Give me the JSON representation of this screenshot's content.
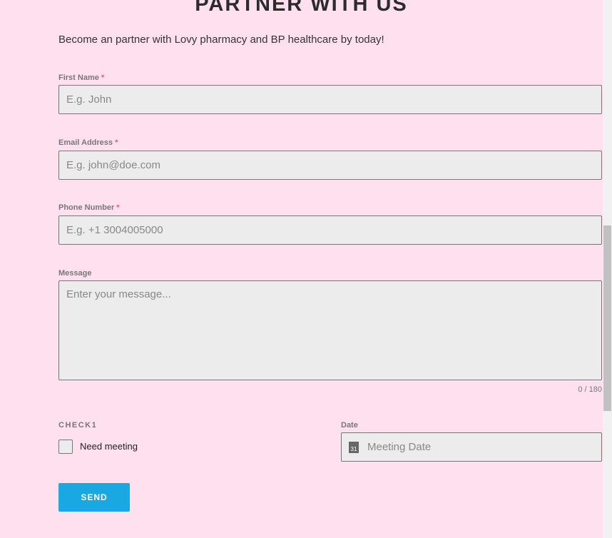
{
  "title": "PARTNER WITH US",
  "subtitle": "Become an partner with Lovy pharmacy and BP healthcare by today!",
  "fields": {
    "first_name": {
      "label": "First Name",
      "required": "*",
      "placeholder": "E.g. John"
    },
    "email": {
      "label": "Email Address",
      "required": "*",
      "placeholder": "E.g. john@doe.com"
    },
    "phone": {
      "label": "Phone Number",
      "required": "*",
      "placeholder": "E.g. +1 3004005000"
    },
    "message": {
      "label": "Message",
      "placeholder": "Enter your message...",
      "counter": "0 / 180"
    },
    "check": {
      "label": "CHECK1",
      "option": "Need meeting"
    },
    "date": {
      "label": "Date",
      "placeholder": "Meeting Date",
      "icon": "calendar-icon",
      "icon_text": "31"
    }
  },
  "send_label": "SEND",
  "colors": {
    "background": "#ffe0ef",
    "button": "#19a8e2"
  }
}
